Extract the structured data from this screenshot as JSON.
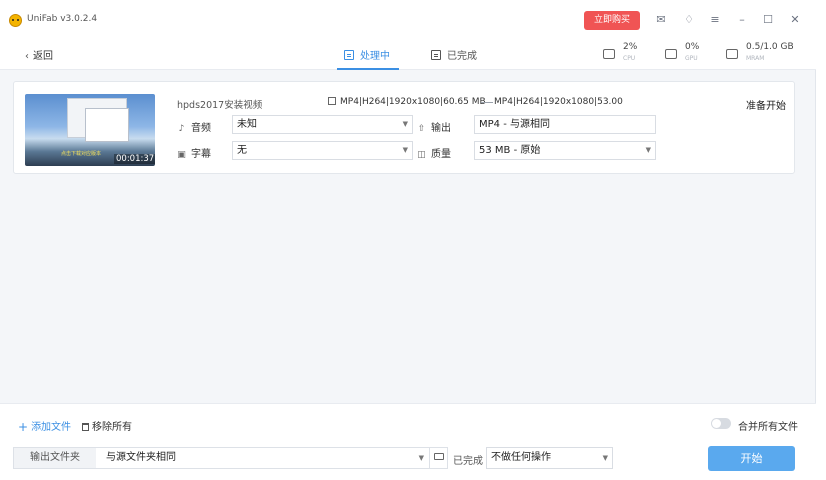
{
  "app": {
    "title": "UniFab v3.0.2.4",
    "buy_label": "立即购买"
  },
  "window_icons": [
    "mail-icon",
    "shirt-icon",
    "menu-icon",
    "minimize-icon",
    "maximize-icon",
    "close-icon"
  ],
  "toolbar": {
    "back_label": "返回",
    "tabs": [
      {
        "label": "处理中",
        "active": true
      },
      {
        "label": "已完成",
        "active": false
      }
    ],
    "stats": [
      {
        "value": "2%",
        "label": "CPU"
      },
      {
        "value": "0%",
        "label": "GPU"
      },
      {
        "value": "0.5/1.0 GB",
        "label": "MRAM"
      }
    ]
  },
  "task": {
    "file_name": "hpds2017安装视频",
    "duration": "00:01:37",
    "thumb_caption": "点击下载对应版本",
    "source_info": "MP4|H264|1920x1080|60.65 MB",
    "target_info": "MP4|H264|1920x1080|53.00",
    "status": "准备开始",
    "audio_label": "音频",
    "audio_value": "未知",
    "subtitle_label": "字幕",
    "subtitle_value": "无",
    "output_label": "输出",
    "output_value": "MP4 - 与源相同",
    "quality_label": "质量",
    "quality_value": "53 MB - 原始"
  },
  "bottom": {
    "add_file": "添加文件",
    "remove_all": "移除所有",
    "merge_label": "合并所有文件",
    "merge_enabled": false,
    "output_folder_label": "输出文件夹",
    "output_folder_value": "与源文件夹相同",
    "done_label": "已完成",
    "done_value": "不做任何操作",
    "start_label": "开始"
  },
  "colors": {
    "accent": "#3b8fe3",
    "buy": "#f05454",
    "start": "#5aa9ee"
  }
}
